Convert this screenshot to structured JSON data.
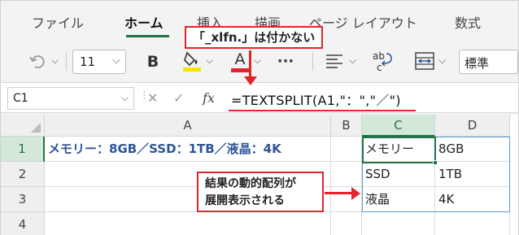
{
  "ribbon": {
    "tabs": [
      "ファイル",
      "ホーム",
      "挿入",
      "描画",
      "ページ レイアウト",
      "数式"
    ],
    "active_tab": "ホーム"
  },
  "toolbar": {
    "undo_icon": "undo-icon",
    "font_size": "11",
    "bold_label": "B",
    "fill_color": "#f5e400",
    "font_color_label": "A",
    "font_color": "#e0262a",
    "more_label": "···",
    "number_format": "標準"
  },
  "formula_bar": {
    "name_box": "C1",
    "fx_label": "fx",
    "formula": "=TEXTSPLIT(A1,\"：\",\"／\")"
  },
  "grid": {
    "columns": [
      "A",
      "B",
      "C",
      "D"
    ],
    "rows": [
      "1",
      "2",
      "3",
      "4"
    ],
    "cells": {
      "A1": "メモリー：8GB／SSD：1TB／液晶：4K",
      "C1": "メモリー",
      "D1": "8GB",
      "C2": "SSD",
      "D2": "1TB",
      "C3": "液晶",
      "D3": "4K"
    }
  },
  "annotations": {
    "top_callout": "「_xlfn.」は付かない",
    "bottom_callout_line1": "結果の動的配列が",
    "bottom_callout_line2": "展開表示される",
    "accent_color": "#e0262a"
  }
}
